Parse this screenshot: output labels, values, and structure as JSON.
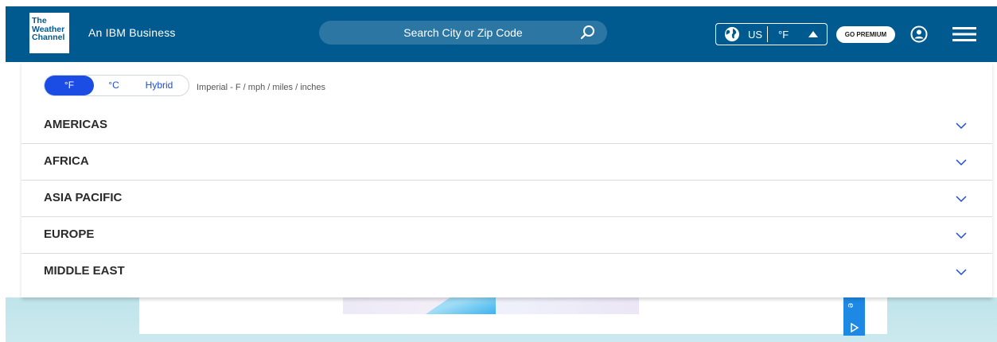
{
  "header": {
    "logo_lines": [
      "The",
      "Weather",
      "Channel"
    ],
    "tagline": "An IBM Business",
    "search": {
      "placeholder": "Search City or Zip Code"
    },
    "locale": {
      "country": "US",
      "unit": "°F"
    },
    "premium_label": "GO PREMIUM"
  },
  "units": {
    "options": [
      "°F",
      "°C",
      "Hybrid"
    ],
    "selected": "°F",
    "description": "Imperial - F / mph / miles / inches"
  },
  "regions": [
    "AMERICAS",
    "AFRICA",
    "ASIA PACIFIC",
    "EUROPE",
    "MIDDLE EAST"
  ],
  "ad": {
    "side_text": "e"
  },
  "colors": {
    "header_bg": "#005a8f",
    "search_bg": "#2c76a4",
    "accent": "#1b4de4",
    "ad_blue": "#1e88e5"
  }
}
